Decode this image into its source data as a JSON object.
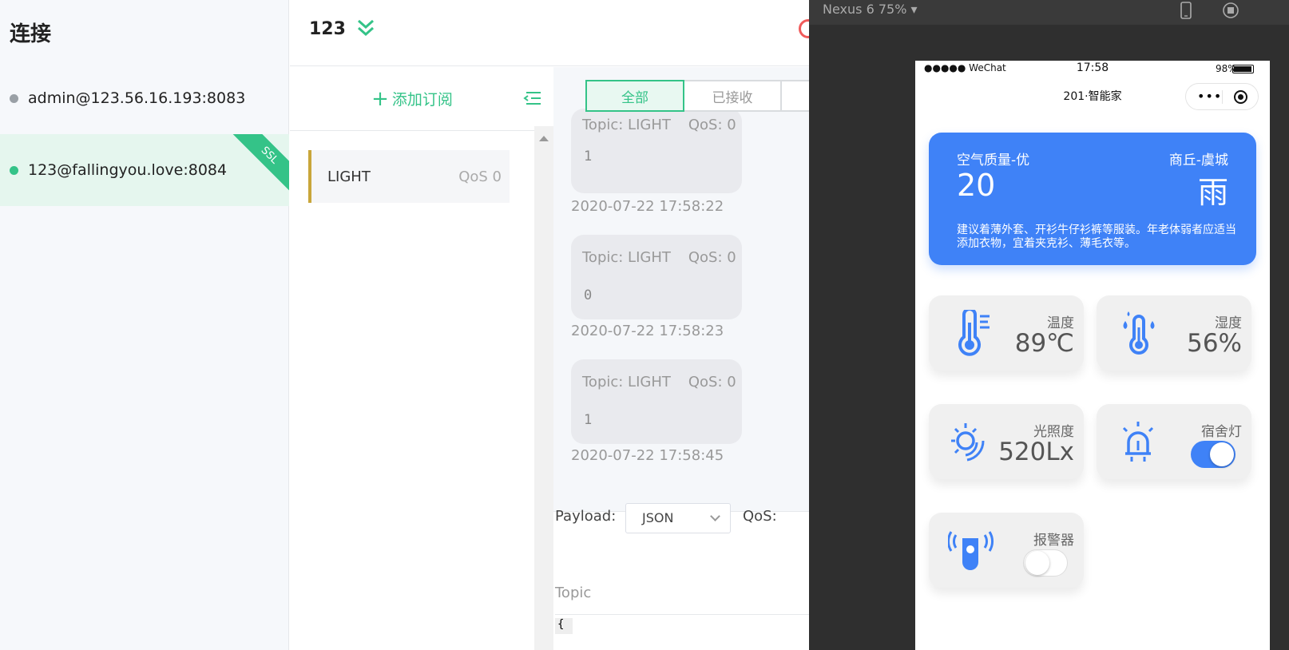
{
  "sidebar": {
    "title": "连接",
    "connections": [
      {
        "label": "admin@123.56.16.193:8083",
        "status_color": "#9aa0a6"
      },
      {
        "label": "123@fallingyou.love:8084",
        "status_color": "#34c388",
        "badge": "SSL"
      }
    ]
  },
  "header": {
    "connection_name": "123"
  },
  "subscriptions": {
    "add_label": "添加订阅",
    "items": [
      {
        "topic": "LIGHT",
        "qos": "QoS 0",
        "color": "#c9a63a"
      }
    ]
  },
  "messages": {
    "tabs": [
      "全部",
      "已接收"
    ],
    "active_tab": "全部",
    "items": [
      {
        "topic": "Topic: LIGHT",
        "qos": "QoS: 0",
        "payload": "1",
        "time": "2020-07-22 17:58:22"
      },
      {
        "topic": "Topic: LIGHT",
        "qos": "QoS: 0",
        "payload": "0",
        "time": "2020-07-22 17:58:23"
      },
      {
        "topic": "Topic: LIGHT",
        "qos": "QoS: 0",
        "payload": "1",
        "time": "2020-07-22 17:58:45"
      }
    ]
  },
  "publish": {
    "payload_label": "Payload:",
    "payload_format": "JSON",
    "qos_label": "QoS:",
    "topic_placeholder": "Topic",
    "editor_first_char": "{"
  },
  "simulator": {
    "device": "Nexus 6 75%",
    "status_bar": {
      "carrier": "●●●●● WeChat",
      "time": "17:58",
      "battery": "98%"
    },
    "nav_title": "201·智能家",
    "weather": {
      "air_label": "空气质量-优",
      "air_value": "20",
      "city": "商丘-虞城",
      "condition": "雨",
      "tip": "建议着薄外套、开衫牛仔衫裤等服装。年老体弱者应适当添加衣物，宜着夹克衫、薄毛衣等。"
    },
    "cards": [
      {
        "label": "温度",
        "value": "89℃",
        "icon": "thermometer-icon"
      },
      {
        "label": "湿度",
        "value": "56%",
        "icon": "humidity-icon"
      },
      {
        "label": "光照度",
        "value": "520Lx",
        "icon": "sun-icon"
      },
      {
        "label": "宿舍灯",
        "toggle": true,
        "icon": "alarm-light-icon"
      },
      {
        "label": "报警器",
        "toggle": false,
        "icon": "buzzer-icon"
      }
    ],
    "accent": "#3f82f7"
  }
}
